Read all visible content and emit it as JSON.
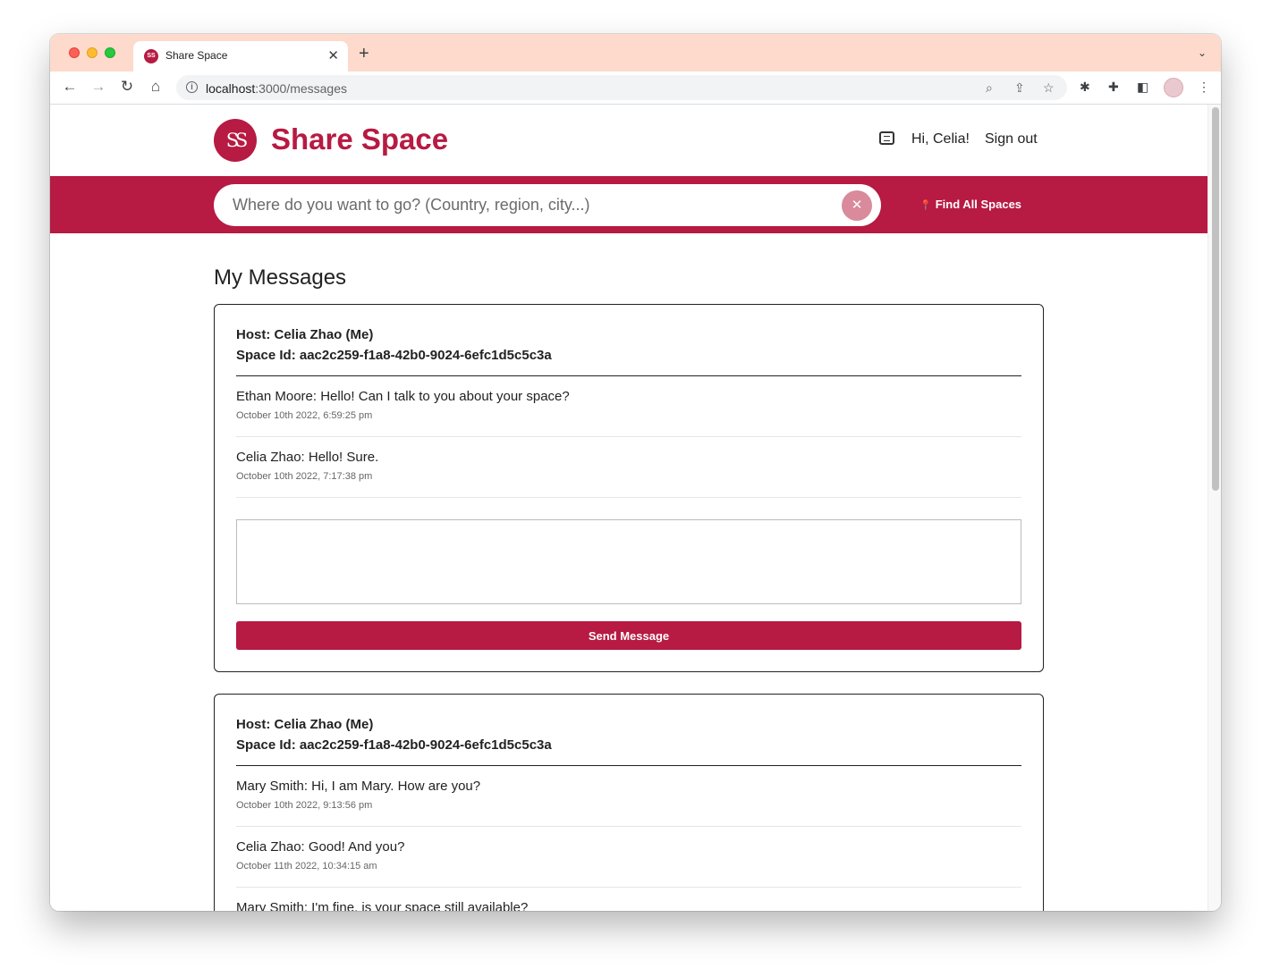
{
  "browser": {
    "tab_title": "Share Space",
    "url_host": "localhost",
    "url_path": ":3000/messages",
    "icons": [
      "back-icon",
      "forward-icon",
      "reload-icon",
      "home-icon",
      "zoom-icon",
      "share-icon",
      "bookmark-star-icon",
      "bug-icon",
      "extensions-icon",
      "sidepanel-icon",
      "profile-avatar",
      "more-menu-icon"
    ]
  },
  "site": {
    "logo_mark": "SS",
    "logo_text": "Share Space",
    "greeting": "Hi, Celia!",
    "sign_out": "Sign out",
    "search_placeholder": "Where do you want to go? (Country, region, city...)",
    "find_all": "Find All Spaces",
    "brand_color": "#b71a42"
  },
  "page": {
    "title": "My Messages",
    "send_label": "Send Message",
    "threads": [
      {
        "host": "Host: Celia Zhao (Me)",
        "space_id": "Space Id: aac2c259-f1a8-42b0-9024-6efc1d5c5c3a",
        "messages": [
          {
            "text": "Ethan Moore: Hello! Can I talk to you about your space?",
            "time": "October 10th 2022, 6:59:25 pm"
          },
          {
            "text": "Celia Zhao: Hello! Sure.",
            "time": "October 10th 2022, 7:17:38 pm"
          }
        ]
      },
      {
        "host": "Host: Celia Zhao (Me)",
        "space_id": "Space Id: aac2c259-f1a8-42b0-9024-6efc1d5c5c3a",
        "messages": [
          {
            "text": "Mary Smith: Hi, I am Mary. How are you?",
            "time": "October 10th 2022, 9:13:56 pm"
          },
          {
            "text": "Celia Zhao: Good! And you?",
            "time": "October 11th 2022, 10:34:15 am"
          },
          {
            "text": "Mary Smith: I'm fine, is your space still available?",
            "time": ""
          }
        ]
      }
    ]
  }
}
